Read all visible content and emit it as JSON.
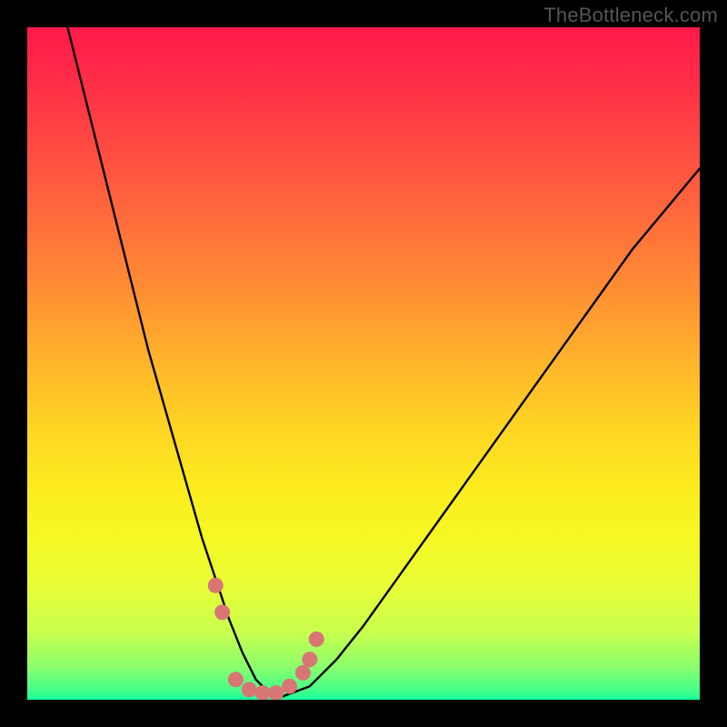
{
  "watermark": "TheBottleneck.com",
  "chart_data": {
    "type": "line",
    "title": "",
    "xlabel": "",
    "ylabel": "",
    "xlim": [
      0,
      100
    ],
    "ylim": [
      0,
      100
    ],
    "series": [
      {
        "name": "bottleneck-curve",
        "x": [
          6,
          8,
          10,
          12,
          14,
          16,
          18,
          20,
          22,
          24,
          26,
          28,
          30,
          32,
          34,
          36,
          38,
          42,
          46,
          50,
          55,
          60,
          65,
          70,
          75,
          80,
          85,
          90,
          95,
          100
        ],
        "y": [
          100,
          92,
          84,
          76,
          68,
          60,
          52,
          45,
          38,
          31,
          24,
          18,
          12,
          7,
          3,
          1,
          0.5,
          2,
          6,
          11,
          18,
          25,
          32,
          39,
          46,
          53,
          60,
          67,
          73,
          79
        ]
      }
    ],
    "markers": {
      "name": "highlight-dots",
      "color": "#d87676",
      "points": [
        {
          "x": 28,
          "y": 17
        },
        {
          "x": 29,
          "y": 13
        },
        {
          "x": 31,
          "y": 3
        },
        {
          "x": 33,
          "y": 1.5
        },
        {
          "x": 35,
          "y": 1
        },
        {
          "x": 37,
          "y": 1
        },
        {
          "x": 39,
          "y": 2
        },
        {
          "x": 41,
          "y": 4
        },
        {
          "x": 42,
          "y": 6
        },
        {
          "x": 43,
          "y": 9
        }
      ]
    },
    "gradient_stops": [
      {
        "pos": 0,
        "color": "#ff1a49"
      },
      {
        "pos": 50,
        "color": "#ffd024"
      },
      {
        "pos": 80,
        "color": "#f5f823"
      },
      {
        "pos": 100,
        "color": "#12ffa1"
      }
    ]
  }
}
